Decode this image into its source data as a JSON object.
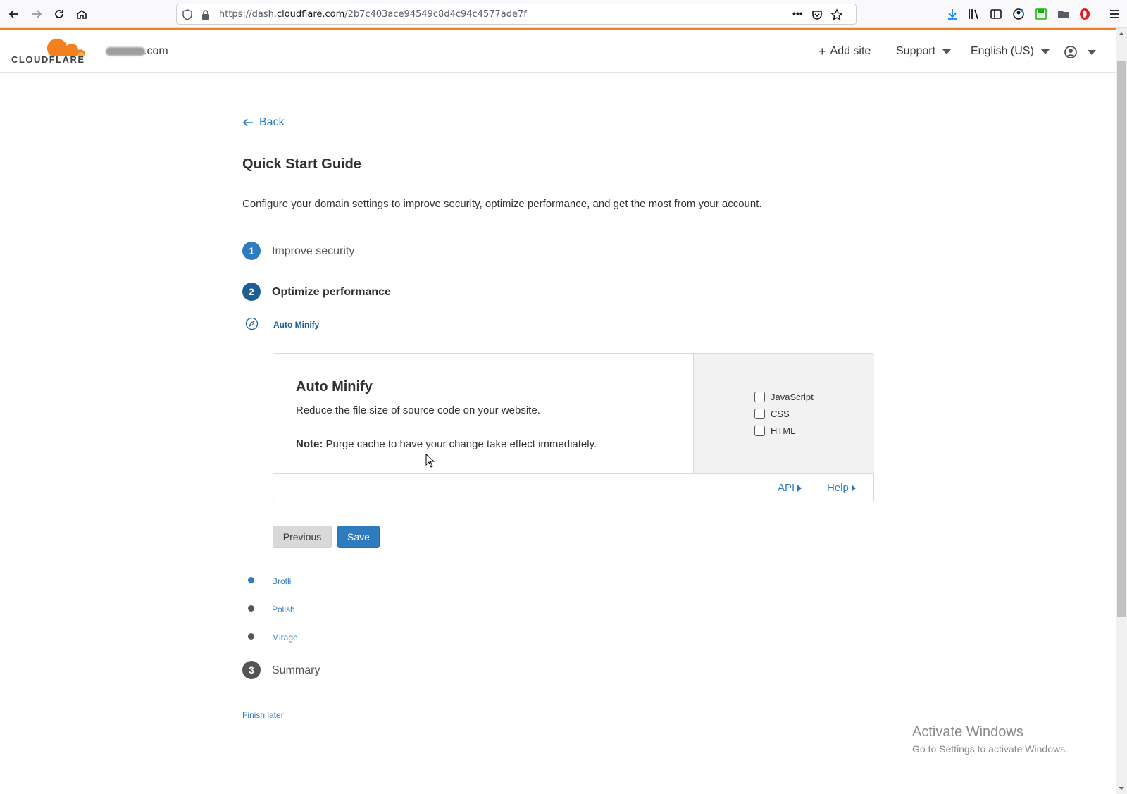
{
  "browser": {
    "url_prefix": "https://dash.",
    "url_domain": "cloudflare.com",
    "url_path": "/2b7c403ace94549c8d4c94c4577ade7f",
    "more_label": "•••"
  },
  "header": {
    "logo_text": "CLOUDFLARE",
    "site_suffix": ".com",
    "add_site": "Add site",
    "support": "Support",
    "language": "English (US)"
  },
  "page": {
    "back": "Back",
    "title": "Quick Start Guide",
    "description": "Configure your domain settings to improve security, optimize performance, and get the most from your account."
  },
  "steps": [
    {
      "number": "1",
      "label": "Improve security"
    },
    {
      "number": "2",
      "label": "Optimize performance"
    },
    {
      "number": "3",
      "label": "Summary"
    }
  ],
  "substeps": {
    "current": "Auto Minify",
    "upcoming": [
      "Brotli",
      "Polish",
      "Mirage"
    ]
  },
  "card": {
    "title": "Auto Minify",
    "description": "Reduce the file size of source code on your website.",
    "note_label": "Note:",
    "note_text": " Purge cache to have your change take effect immediately.",
    "options": [
      "JavaScript",
      "CSS",
      "HTML"
    ],
    "api_link": "API",
    "help_link": "Help"
  },
  "buttons": {
    "previous": "Previous",
    "save": "Save"
  },
  "finish_later": "Finish later",
  "watermark": {
    "line1": "Activate Windows",
    "line2": "Go to Settings to activate Windows."
  },
  "colors": {
    "accent": "#2f7bbf",
    "brand_orange": "#f38020",
    "step_active": "#1e5e93",
    "step_inactive": "#555555"
  }
}
